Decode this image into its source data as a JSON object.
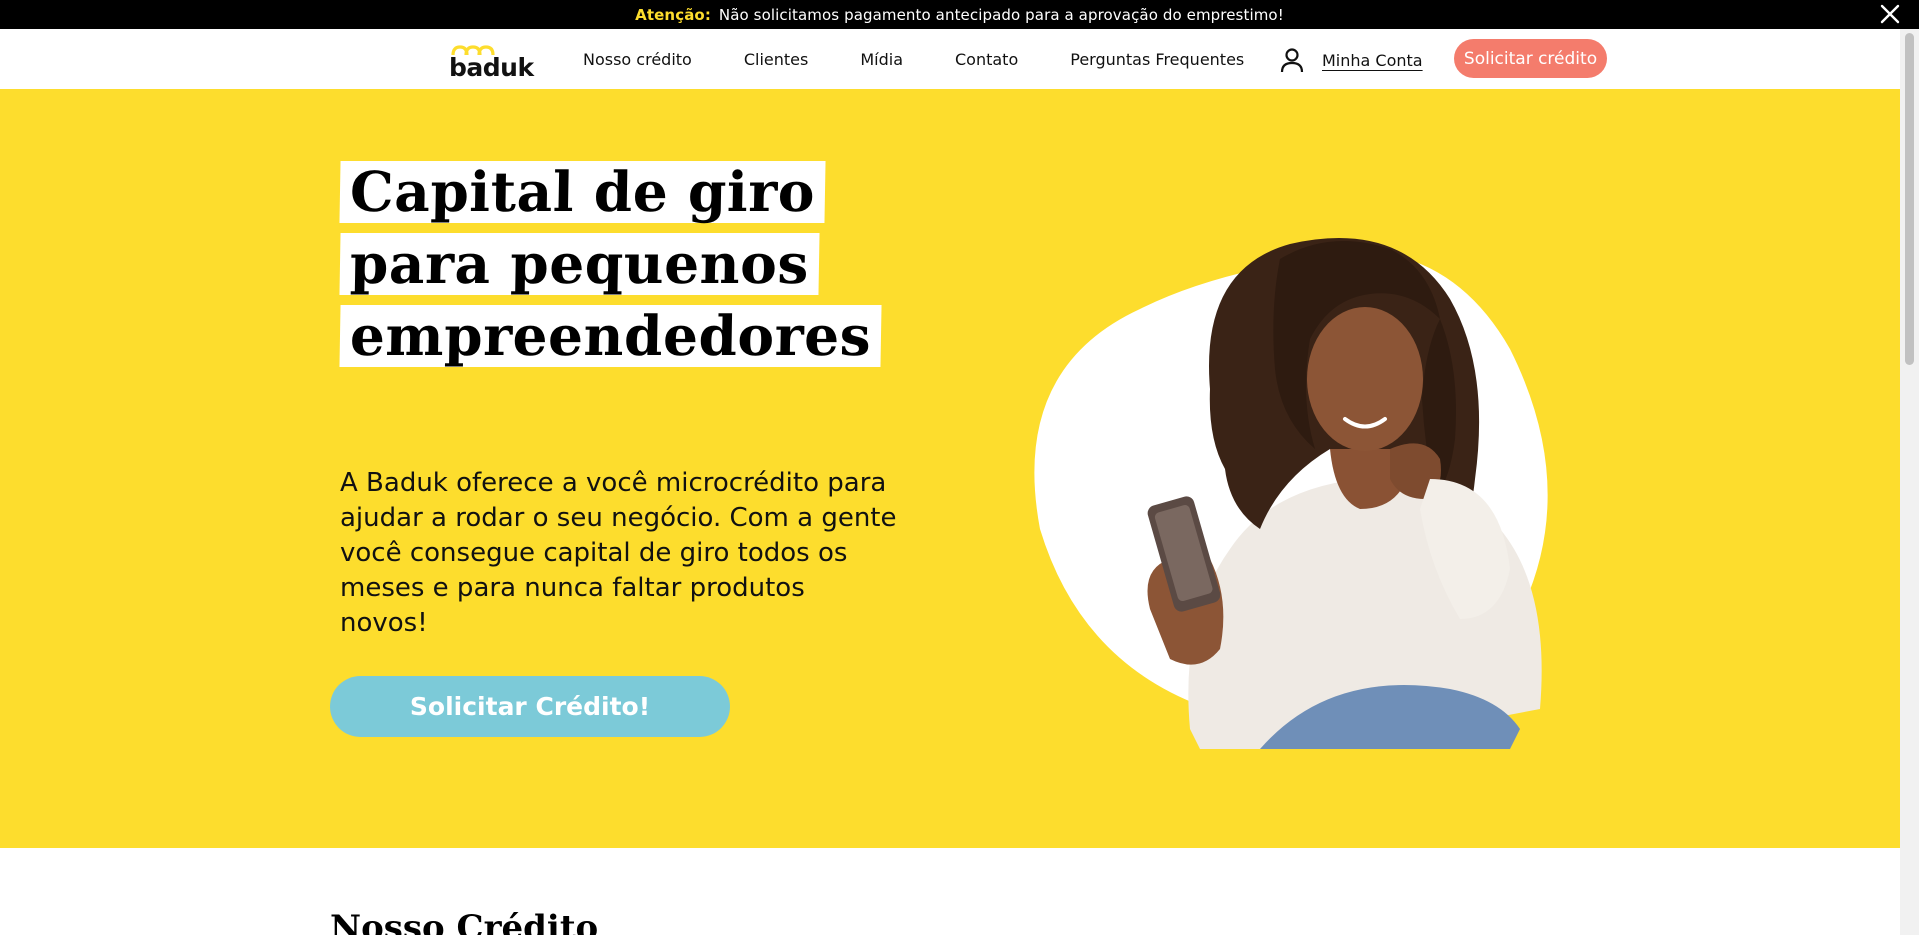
{
  "announcement": {
    "label": "Atenção:",
    "text": "Não solicitamos pagamento antecipado para a aprovação do emprestimo!",
    "close_icon": "close-icon"
  },
  "header": {
    "logo_text": "baduk",
    "nav": [
      "Nosso crédito",
      "Clientes",
      "Mídia",
      "Contato",
      "Perguntas Frequentes"
    ],
    "account_icon": "user-icon",
    "account_label": "Minha Conta",
    "cta_label": "Solicitar crédito"
  },
  "hero": {
    "headline_lines": [
      "Capital de giro",
      "para pequenos",
      "empreendedores"
    ],
    "description": "A Baduk oferece a você microcrédito para ajudar a rodar o seu negócio. Com a gente você consegue capital de giro todos os meses e para nunca faltar produtos novos!",
    "cta_label": "Solicitar Crédito!"
  },
  "next_section": {
    "title": "Nosso Crédito"
  },
  "colors": {
    "brand_yellow": "#fddd2d",
    "cta_coral": "#f47c6c",
    "cta_blue": "#7ccad8",
    "announce_bg": "#000000"
  }
}
